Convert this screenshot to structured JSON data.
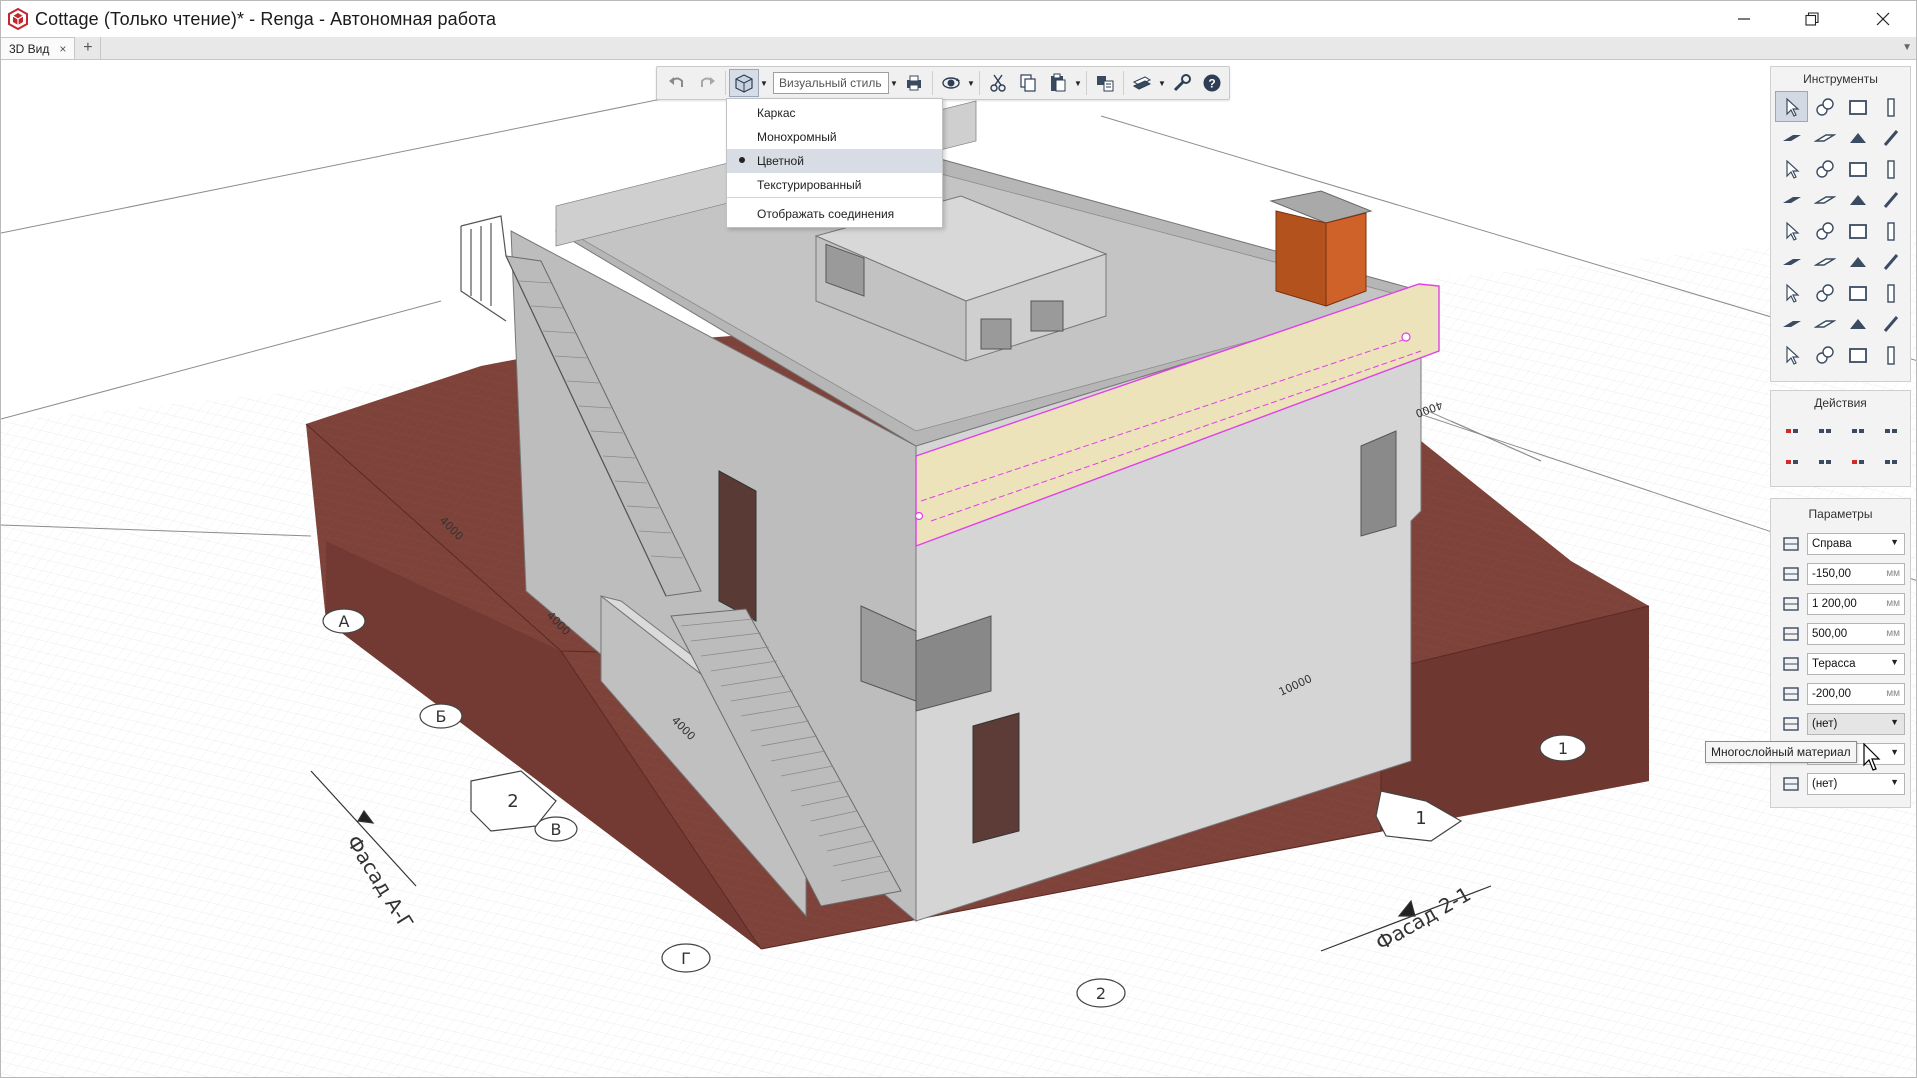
{
  "window": {
    "title": "Cottage (Только чтение)* - Renga - Автономная работа"
  },
  "tabs": [
    {
      "label": "3D Вид",
      "close": "×"
    }
  ],
  "tab_add": "+",
  "toolbar": {
    "visual_style_placeholder": "Визуальный стиль",
    "icons": [
      "undo-icon",
      "redo-icon",
      "visual-style-icon",
      "print-icon",
      "orbit-icon",
      "cut-icon",
      "copy-icon",
      "paste-icon",
      "layers-icon",
      "views-icon",
      "settings-wrench-icon",
      "help-icon"
    ]
  },
  "style_menu": {
    "items": [
      {
        "label": "Каркас",
        "selected": false
      },
      {
        "label": "Монохромный",
        "selected": false
      },
      {
        "label": "Цветной",
        "selected": true
      },
      {
        "label": "Текстурированный",
        "selected": false
      },
      {
        "label": "Отображать соединения",
        "selected": false
      }
    ]
  },
  "panels": {
    "tools": {
      "title": "Инструменты"
    },
    "actions": {
      "title": "Действия"
    },
    "params": {
      "title": "Параметры",
      "fields": [
        {
          "value": "Справа",
          "unit": "",
          "type": "select"
        },
        {
          "value": "-150,00",
          "unit": "мм",
          "type": "number"
        },
        {
          "value": "1 200,00",
          "unit": "мм",
          "type": "number"
        },
        {
          "value": "500,00",
          "unit": "мм",
          "type": "number"
        },
        {
          "value": "Терасса",
          "unit": "",
          "type": "select"
        },
        {
          "value": "-200,00",
          "unit": "мм",
          "type": "number"
        },
        {
          "value": "(нет)",
          "unit": "",
          "type": "select"
        },
        {
          "value": "",
          "unit": "",
          "type": "select"
        },
        {
          "value": "(нет)",
          "unit": "",
          "type": "select"
        }
      ],
      "tooltip": "Многослойный материал"
    }
  },
  "scene_labels": {
    "axis_a": "А",
    "axis_b": "Б",
    "axis_v": "В",
    "axis_g": "Г",
    "axis_1": "1",
    "axis_2": "2",
    "section_2": "2",
    "section_1": "1",
    "facade_ag": "Фасад А-Г",
    "facade_21": "Фасад 2-1",
    "dim_4000a": "4000",
    "dim_4000b": "4000",
    "dim_4000c": "4000",
    "dim_10000": "10000",
    "dim_4000d": "4000"
  },
  "colors": {
    "ground": "#7b4038",
    "wall": "#c8c8c8",
    "chimney": "#c55a24",
    "highlight": "#ece2b8",
    "highlight_edge": "#e040e8"
  }
}
